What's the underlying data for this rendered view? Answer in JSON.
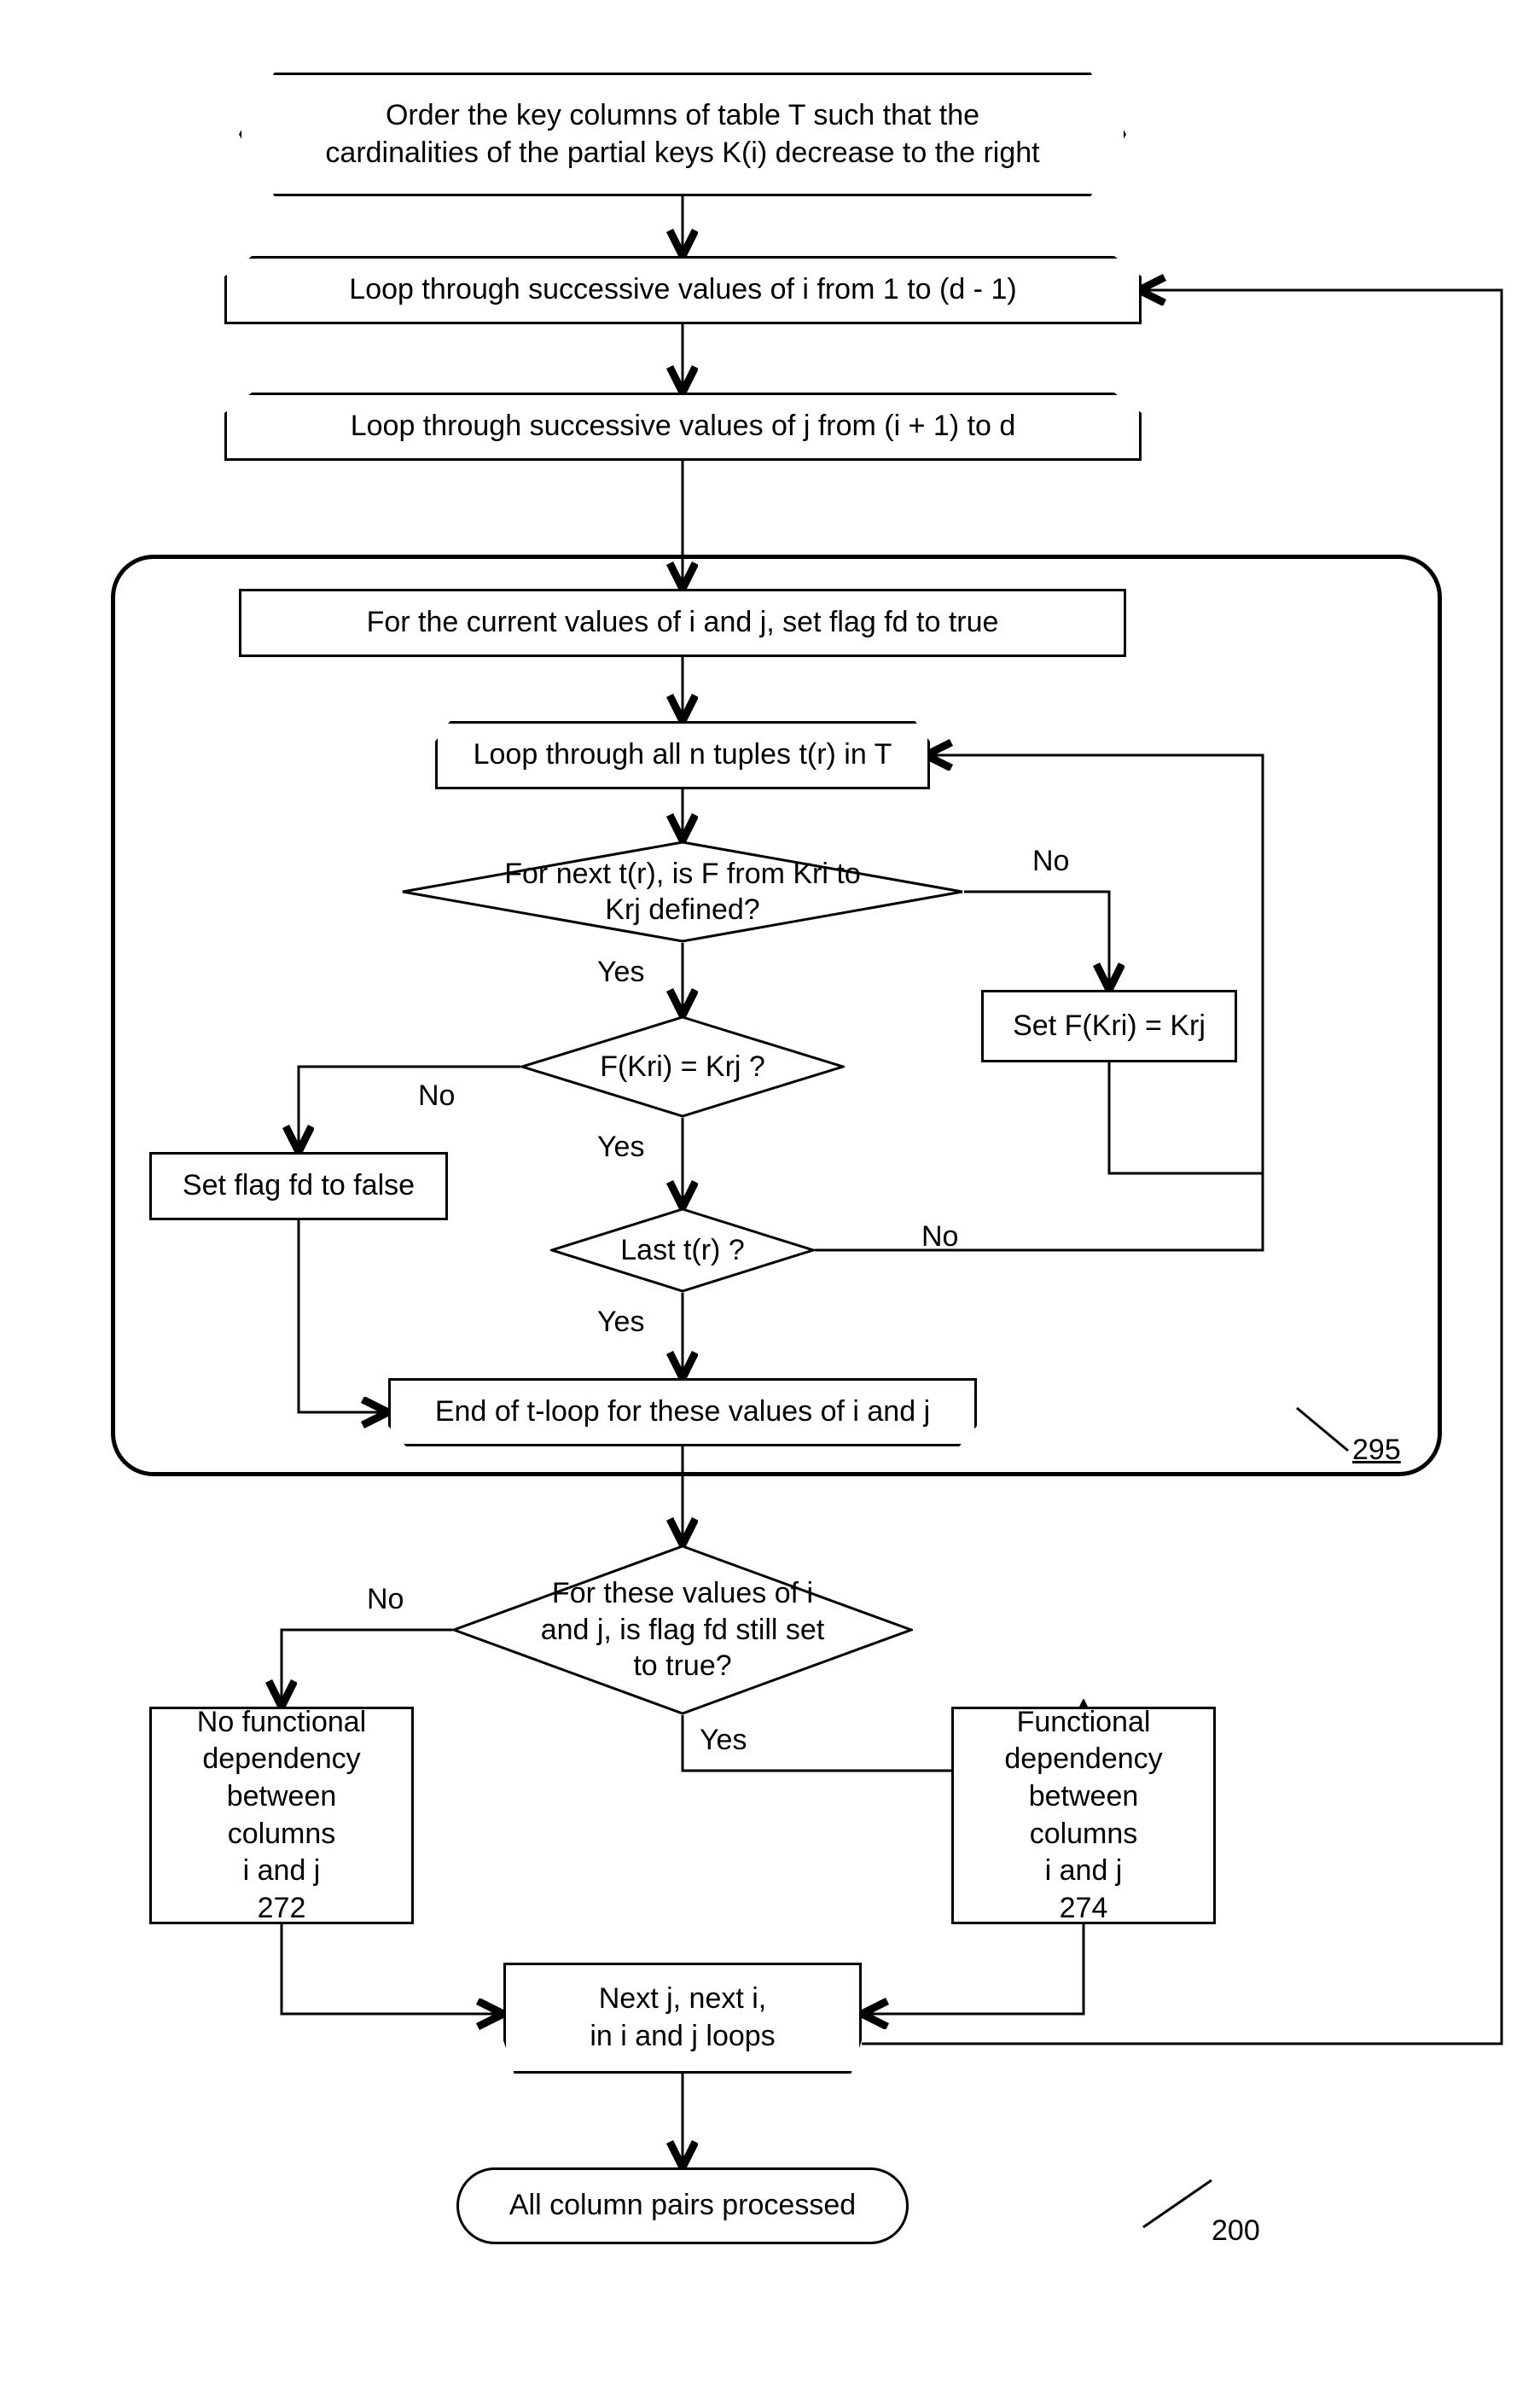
{
  "chart_data": {
    "type": "flowchart",
    "nodes": [
      {
        "id": "n1",
        "shape": "preparation",
        "text": "Order the key columns of table T such that the cardinalities of the partial keys K(i) decrease to the right"
      },
      {
        "id": "n2",
        "shape": "loop-start",
        "text": "Loop through successive values of i from 1 to (d - 1)"
      },
      {
        "id": "n3",
        "shape": "loop-start",
        "text": "Loop through successive values of j from (i + 1) to d"
      },
      {
        "id": "n4",
        "shape": "process",
        "text": "For the current values of i and j, set flag fd to true"
      },
      {
        "id": "n5",
        "shape": "loop-start",
        "text": "Loop through all n tuples t(r) in T"
      },
      {
        "id": "n6",
        "shape": "decision",
        "text": "For next t(r), is F from Kri to Krj defined?"
      },
      {
        "id": "n7",
        "shape": "process",
        "text": "Set F(Kri) = Krj"
      },
      {
        "id": "n8",
        "shape": "decision",
        "text": "F(Kri) = Krj ?"
      },
      {
        "id": "n9",
        "shape": "process",
        "text": "Set flag fd to false"
      },
      {
        "id": "n10",
        "shape": "decision",
        "text": "Last t(r) ?"
      },
      {
        "id": "n11",
        "shape": "loop-end",
        "text": "End of t-loop for these values of i and j"
      },
      {
        "id": "n12",
        "shape": "decision",
        "text": "For these values of i and j, is flag fd still set to true?"
      },
      {
        "id": "n13",
        "shape": "process",
        "text": "No functional dependency between columns i and j\n272"
      },
      {
        "id": "n14",
        "shape": "process",
        "text": "Functional dependency between columns i and j\n274"
      },
      {
        "id": "n15",
        "shape": "loop-end",
        "text": "Next j, next i, in i and j loops"
      },
      {
        "id": "n16",
        "shape": "terminator",
        "text": "All column pairs processed"
      }
    ],
    "edges": [
      {
        "from": "n1",
        "to": "n2"
      },
      {
        "from": "n2",
        "to": "n3"
      },
      {
        "from": "n3",
        "to": "n4"
      },
      {
        "from": "n4",
        "to": "n5"
      },
      {
        "from": "n5",
        "to": "n6"
      },
      {
        "from": "n6",
        "to": "n7",
        "label": "No"
      },
      {
        "from": "n6",
        "to": "n8",
        "label": "Yes"
      },
      {
        "from": "n7",
        "to": "n5",
        "label": "loop-back"
      },
      {
        "from": "n8",
        "to": "n9",
        "label": "No"
      },
      {
        "from": "n8",
        "to": "n10",
        "label": "Yes"
      },
      {
        "from": "n10",
        "to": "n5",
        "label": "No (loop-back)"
      },
      {
        "from": "n10",
        "to": "n11",
        "label": "Yes"
      },
      {
        "from": "n9",
        "to": "n11"
      },
      {
        "from": "n11",
        "to": "n12"
      },
      {
        "from": "n12",
        "to": "n13",
        "label": "No"
      },
      {
        "from": "n12",
        "to": "n14",
        "label": "Yes"
      },
      {
        "from": "n13",
        "to": "n15"
      },
      {
        "from": "n14",
        "to": "n15"
      },
      {
        "from": "n15",
        "to": "n16"
      },
      {
        "from": "n15",
        "to": "n2",
        "label": "loop-back"
      }
    ],
    "refs": {
      "group": "295",
      "figure": "200"
    }
  },
  "texts": {
    "n1": "Order the key columns of table T such that the cardinalities of the partial keys K(i) decrease to the right",
    "n2": "Loop through successive values of i from 1 to (d - 1)",
    "n3": "Loop through successive values of j from (i + 1) to d",
    "n4": "For the current values of i and j, set flag fd to true",
    "n5": "Loop through all n tuples t(r) in T",
    "n6": "For next t(r), is F from Kri to Krj defined?",
    "n7": "Set F(Kri) = Krj",
    "n8": "F(Kri) = Krj ?",
    "n9": "Set flag fd to false",
    "n10": "Last t(r) ?",
    "n11": "End of t-loop for these values of i and j",
    "n12": "For these values of i and j, is flag fd still set to true?",
    "n13_l1": "No functional",
    "n13_l2": "dependency",
    "n13_l3": "between columns",
    "n13_l4": "i and j",
    "n13_l5": "272",
    "n14_l1": "Functional",
    "n14_l2": "dependency",
    "n14_l3": "between columns",
    "n14_l4": "i and j",
    "n14_l5": "274",
    "n15_l1": "Next j, next i,",
    "n15_l2": "in i and j loops",
    "n16": "All column pairs processed",
    "yes": "Yes",
    "no": "No",
    "ref295": "295",
    "ref200": "200"
  }
}
